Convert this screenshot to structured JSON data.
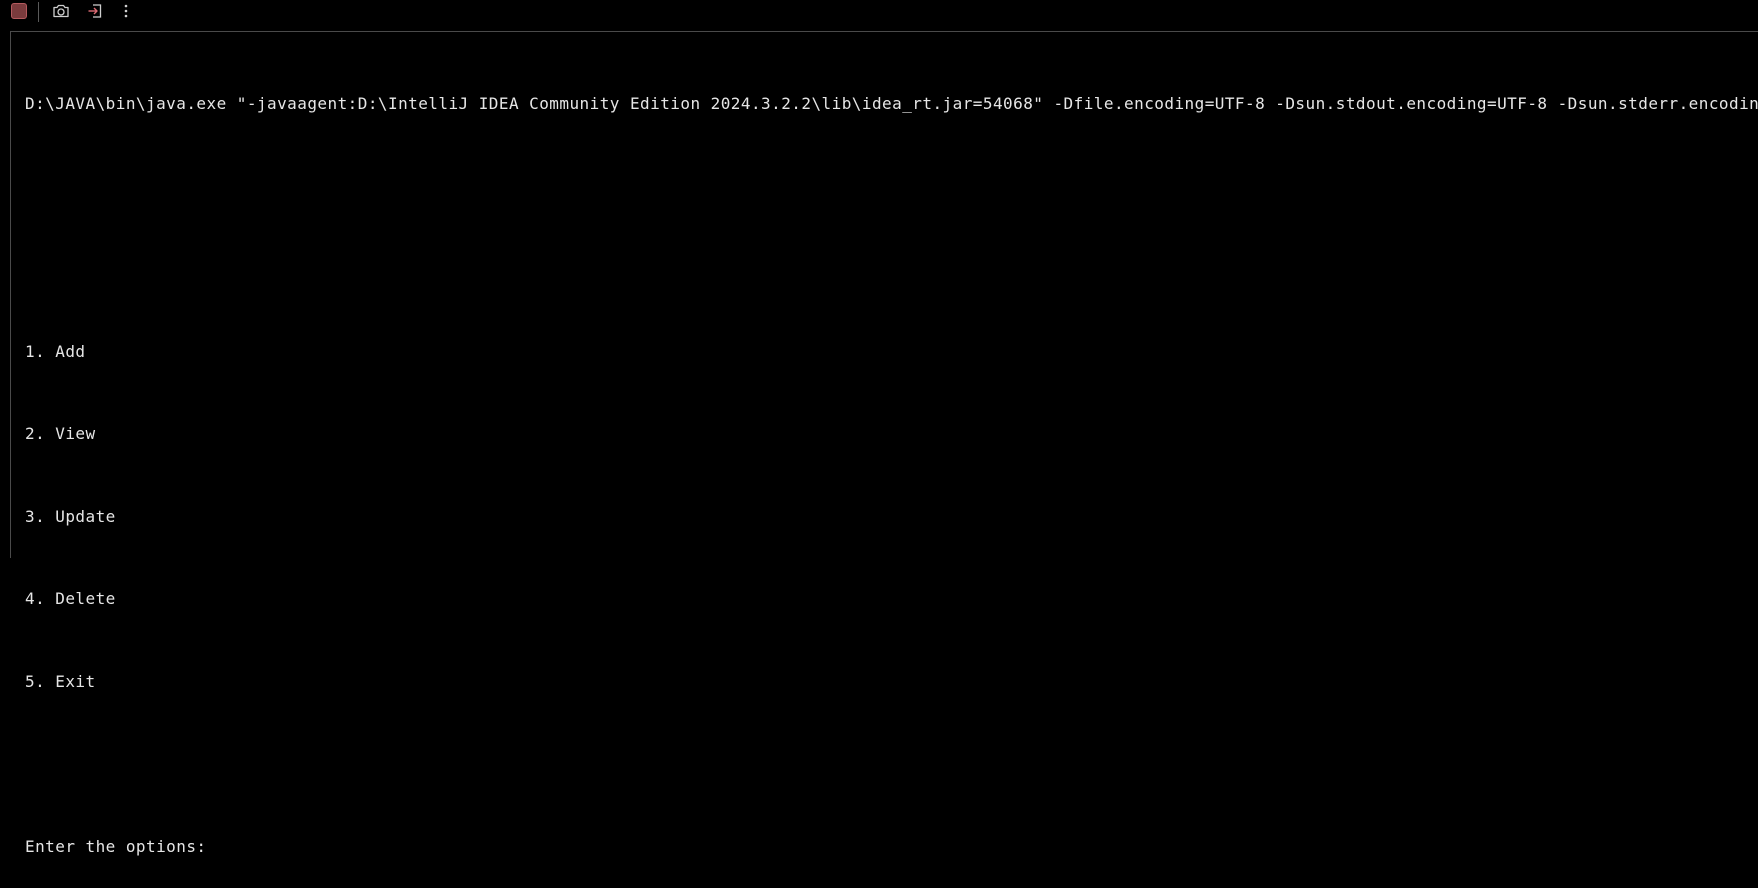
{
  "toolbar": {
    "stop_icon": "stop-icon",
    "camera_icon": "camera-icon",
    "exit_icon": "exit-icon",
    "more_icon": "more-vertical-icon",
    "stop_color": "#7a3b3d"
  },
  "console": {
    "command_line": "D:\\JAVA\\bin\\java.exe \"-javaagent:D:\\IntelliJ IDEA Community Edition 2024.3.2.2\\lib\\idea_rt.jar=54068\" -Dfile.encoding=UTF-8 -Dsun.stdout.encoding=UTF-8 -Dsun.stderr.encoding=",
    "menu": [
      "1. Add",
      "2. View",
      "3. Update",
      "4. Delete",
      "5. Exit"
    ],
    "prompt": "Enter the options:"
  },
  "colors": {
    "background": "#000000",
    "text": "#e6e6e6",
    "divider": "#4a4a4a"
  }
}
